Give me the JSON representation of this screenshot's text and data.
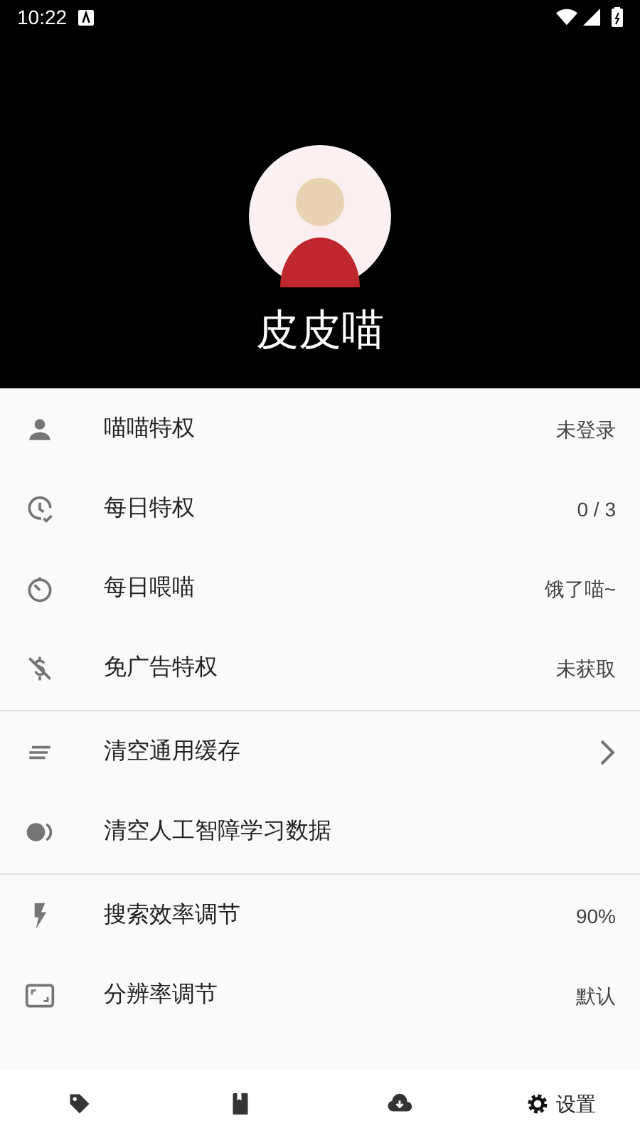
{
  "status_bar": {
    "time": "10:22"
  },
  "profile": {
    "name": "皮皮喵"
  },
  "sections": [
    {
      "items": [
        {
          "label": "喵喵特权",
          "kind": "value",
          "value": "未登录"
        },
        {
          "label": "每日特权",
          "kind": "value",
          "value": "0 / 3"
        },
        {
          "label": "每日喂喵",
          "kind": "value",
          "value": "饿了喵~"
        },
        {
          "label": "免广告特权",
          "kind": "value",
          "value": "未获取"
        }
      ]
    },
    {
      "items": [
        {
          "label": "清空通用缓存",
          "kind": "chevron"
        },
        {
          "label": "清空人工智障学习数据",
          "kind": "plain"
        }
      ]
    },
    {
      "items": [
        {
          "label": "搜索效率调节",
          "kind": "value",
          "value": "90%"
        },
        {
          "label": "分辨率调节",
          "kind": "value",
          "value": "默认"
        }
      ]
    }
  ],
  "bottom_nav": [
    {
      "selected": false
    },
    {
      "selected": false
    },
    {
      "selected": false
    },
    {
      "label": "设置",
      "selected": true
    }
  ]
}
